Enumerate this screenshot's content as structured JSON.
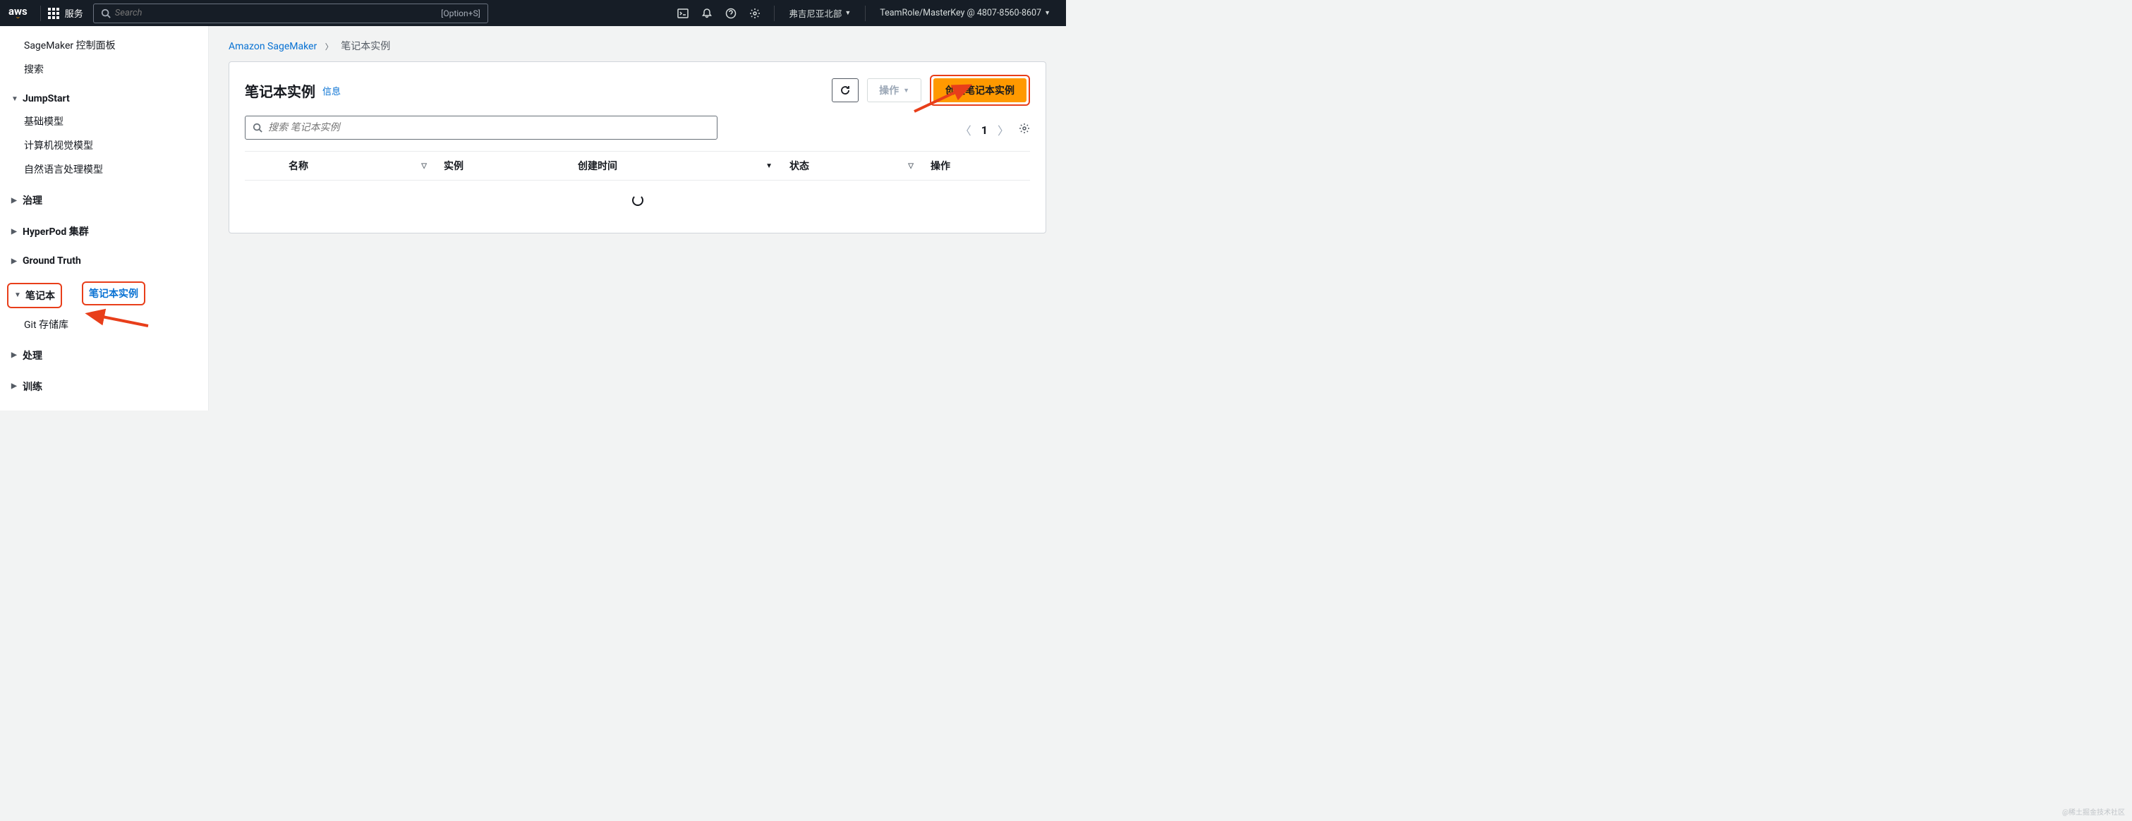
{
  "header": {
    "logo": "aws",
    "services_label": "服务",
    "search_placeholder": "Search",
    "search_shortcut": "[Option+S]",
    "region_label": "弗吉尼亚北部",
    "account_label": "TeamRole/MasterKey @ 4807-8560-8607"
  },
  "sidebar": {
    "items_top": [
      {
        "label": "SageMaker 控制面板",
        "sub": true
      },
      {
        "label": "搜索",
        "sub": true
      }
    ],
    "jumpstart": {
      "label": "JumpStart",
      "expanded": true,
      "children": [
        {
          "label": "基础模型"
        },
        {
          "label": "计算机视觉模型"
        },
        {
          "label": "自然语言处理模型"
        }
      ]
    },
    "sections": [
      {
        "label": "治理",
        "expanded": false
      },
      {
        "label": "HyperPod 集群",
        "expanded": false
      },
      {
        "label": "Ground Truth",
        "expanded": false
      }
    ],
    "notebook": {
      "label": "笔记本",
      "expanded": true,
      "children": [
        {
          "label": "笔记本实例",
          "active": true
        },
        {
          "label": "Git 存储库",
          "active": false
        }
      ]
    },
    "sections_after": [
      {
        "label": "处理",
        "expanded": false
      },
      {
        "label": "训练",
        "expanded": false
      }
    ]
  },
  "breadcrumb": {
    "root": "Amazon SageMaker",
    "current": "笔记本实例"
  },
  "panel": {
    "title": "笔记本实例",
    "info_label": "信息",
    "actions_label": "操作",
    "create_label": "创建笔记本实例",
    "search_placeholder": "搜索 笔记本实例",
    "page_number": "1",
    "columns": {
      "name": "名称",
      "instance": "实例",
      "created": "创建时间",
      "status": "状态",
      "action": "操作"
    }
  },
  "watermark": "@稀土掘金技术社区"
}
